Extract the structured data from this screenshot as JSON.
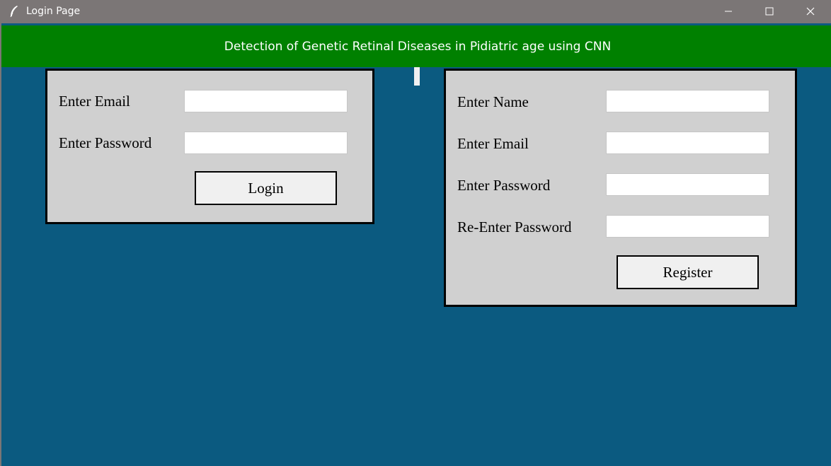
{
  "window": {
    "title": "Login Page",
    "icons": {
      "app": "feather-icon",
      "minimize": "minimize-icon",
      "maximize": "maximize-icon",
      "close": "close-icon"
    }
  },
  "header": {
    "title": "Detection of Genetic Retinal Diseases in Pidiatric age using CNN"
  },
  "login": {
    "email_label": "Enter Email",
    "email_value": "",
    "password_label": "Enter Password",
    "password_value": "",
    "button_label": "Login"
  },
  "register": {
    "name_label": "Enter Name",
    "name_value": "",
    "email_label": "Enter Email",
    "email_value": "",
    "password_label": "Enter Password",
    "password_value": "",
    "reenter_label": "Re-Enter Password",
    "reenter_value": "",
    "button_label": "Register"
  },
  "colors": {
    "background": "#0b5a80",
    "banner": "#008000",
    "titlebar": "#7b7676",
    "panel": "#d0d0d0"
  }
}
